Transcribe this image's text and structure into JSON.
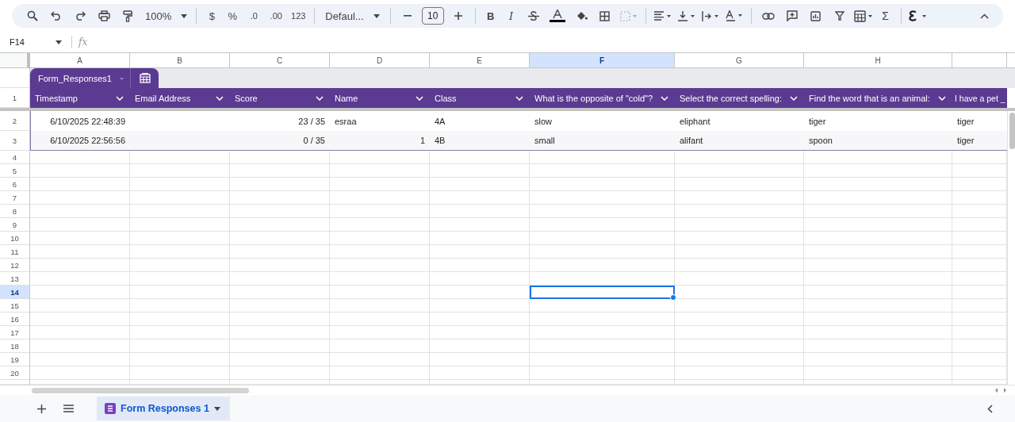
{
  "toolbar": {
    "zoom": "100%",
    "currency": "$",
    "percent": "%",
    "decrease_decimal": ".0",
    "increase_decimal": ".00",
    "number_format": "123",
    "font": "Defaul...",
    "font_size": "10",
    "bold": "B",
    "italic": "I",
    "sum": "Σ"
  },
  "formula_bar": {
    "cell_ref": "F14",
    "formula_label": "fx"
  },
  "column_headers": [
    {
      "label": "A",
      "selected": false
    },
    {
      "label": "B",
      "selected": false
    },
    {
      "label": "C",
      "selected": false
    },
    {
      "label": "D",
      "selected": false
    },
    {
      "label": "E",
      "selected": false
    },
    {
      "label": "F",
      "selected": true
    },
    {
      "label": "G",
      "selected": false
    },
    {
      "label": "H",
      "selected": false
    }
  ],
  "table": {
    "name": "Form_Responses1",
    "columns": [
      "Timestamp",
      "Email Address",
      "Score",
      "Name",
      "Class",
      "What is the opposite of \"cold\"?",
      "Select the correct spelling:",
      "Find the word that is an animal:",
      "I have a pet _"
    ],
    "rows": [
      [
        {
          "text": "6/10/2025 22:48:39",
          "kind": "number"
        },
        null,
        {
          "text": "23 / 35",
          "kind": "number"
        },
        {
          "text": "esraa",
          "kind": "text"
        },
        {
          "text": "4A",
          "kind": "text"
        },
        {
          "text": "slow",
          "kind": "text"
        },
        {
          "text": "eliphant",
          "kind": "text"
        },
        {
          "text": "tiger",
          "kind": "text"
        },
        {
          "text": "tiger",
          "kind": "text"
        }
      ],
      [
        {
          "text": "6/10/2025 22:56:56",
          "kind": "number"
        },
        null,
        {
          "text": "0 / 35",
          "kind": "number"
        },
        {
          "text": "1",
          "kind": "number"
        },
        {
          "text": "4B",
          "kind": "text"
        },
        {
          "text": "small",
          "kind": "text"
        },
        {
          "text": "alifant",
          "kind": "text"
        },
        {
          "text": "spoon",
          "kind": "text"
        },
        {
          "text": "tiger",
          "kind": "text"
        }
      ]
    ]
  },
  "row_headers": [
    {
      "label": "1",
      "selected": false
    },
    {
      "label": "2",
      "selected": false
    },
    {
      "label": "3",
      "selected": false
    },
    {
      "label": "4",
      "selected": false
    },
    {
      "label": "5",
      "selected": false
    },
    {
      "label": "6",
      "selected": false
    },
    {
      "label": "7",
      "selected": false
    },
    {
      "label": "8",
      "selected": false
    },
    {
      "label": "9",
      "selected": false
    },
    {
      "label": "10",
      "selected": false
    },
    {
      "label": "11",
      "selected": false
    },
    {
      "label": "12",
      "selected": false
    },
    {
      "label": "13",
      "selected": false
    },
    {
      "label": "14",
      "selected": true
    },
    {
      "label": "15",
      "selected": false
    },
    {
      "label": "16",
      "selected": false
    },
    {
      "label": "17",
      "selected": false
    },
    {
      "label": "18",
      "selected": false
    },
    {
      "label": "19",
      "selected": false
    },
    {
      "label": "20",
      "selected": false
    }
  ],
  "sheet_tabs": [
    {
      "label": "Form Responses 1",
      "selected": true
    }
  ]
}
